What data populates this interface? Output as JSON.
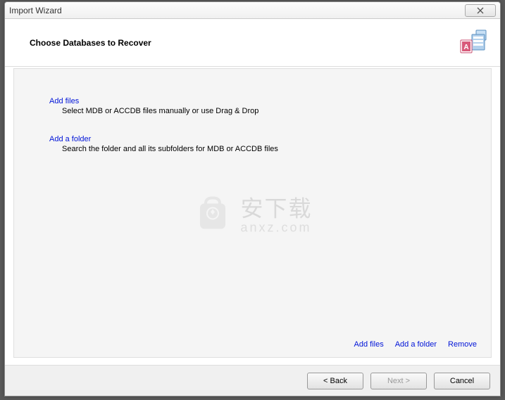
{
  "window": {
    "title": "Import Wizard"
  },
  "header": {
    "title": "Choose Databases to Recover"
  },
  "options": {
    "addFiles": {
      "label": "Add files",
      "description": "Select MDB or ACCDB files manually or use Drag & Drop"
    },
    "addFolder": {
      "label": "Add a folder",
      "description": "Search the folder and all its subfolders for MDB or ACCDB files"
    }
  },
  "bottomLinks": {
    "addFiles": "Add files",
    "addFolder": "Add a folder",
    "remove": "Remove"
  },
  "footer": {
    "back": "< Back",
    "next": "Next >",
    "cancel": "Cancel"
  },
  "watermark": {
    "chars": "安下载",
    "url": "anxz.com"
  }
}
